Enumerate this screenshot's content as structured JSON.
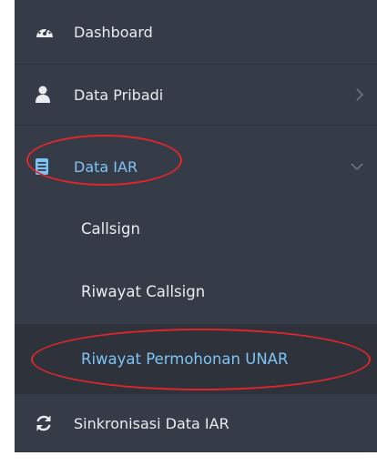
{
  "menu": {
    "dashboard": {
      "label": "Dashboard",
      "icon": "dashboard-gauge-icon"
    },
    "data_pribadi": {
      "label": "Data Pribadi",
      "icon": "user-icon"
    },
    "data_iar": {
      "label": "Data IAR",
      "icon": "book-icon",
      "expanded": true
    },
    "sub_items": [
      {
        "label": "Callsign"
      },
      {
        "label": "Riwayat Callsign"
      },
      {
        "label": "Riwayat Permohonan UNAR",
        "active": true
      }
    ],
    "sinkronisasi": {
      "label": "Sinkronisasi Data IAR",
      "icon": "refresh-icon"
    }
  },
  "colors": {
    "sidebar_bg": "#363c47",
    "active_sub_bg": "#2d323b",
    "accent": "#7fc3f5",
    "highlight_ring": "#e0262b"
  }
}
